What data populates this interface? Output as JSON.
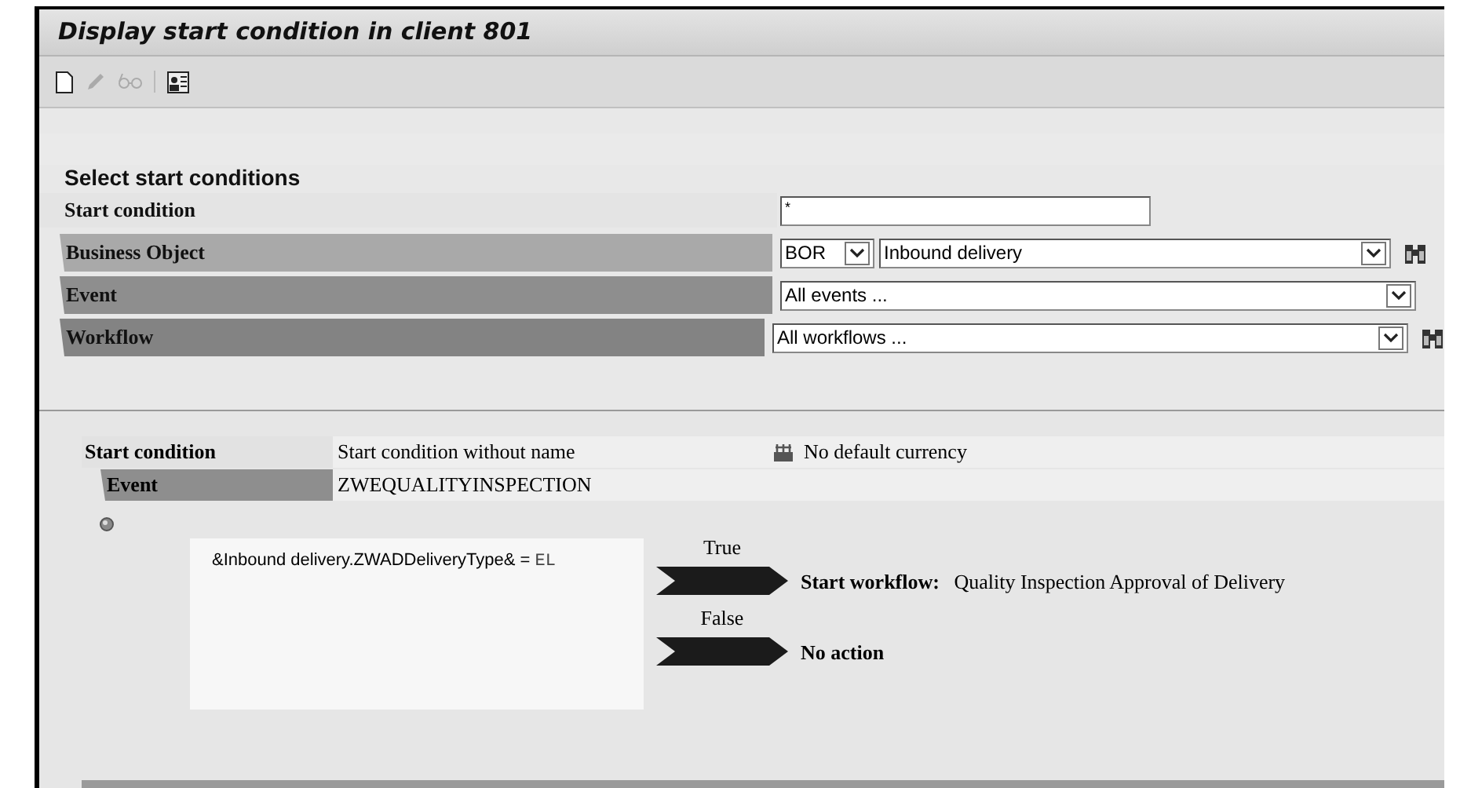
{
  "window": {
    "title": "Display start condition in client 801"
  },
  "toolbar": [
    {
      "kind": "new",
      "disabled": false
    },
    {
      "kind": "edit",
      "disabled": true
    },
    {
      "kind": "glasses",
      "disabled": true
    },
    {
      "kind": "separator"
    },
    {
      "kind": "info",
      "disabled": false
    }
  ],
  "select_section": {
    "title": "Select start conditions",
    "rows": [
      {
        "label": "Start condition",
        "kind": "text",
        "value": "*",
        "search": false
      },
      {
        "label": "Business Object",
        "kind": "object",
        "type_value": "BOR",
        "value": "Inbound delivery",
        "search": true
      },
      {
        "label": "Event",
        "kind": "select",
        "value": "All events ...",
        "search": false
      },
      {
        "label": "Workflow",
        "kind": "select",
        "value": "All workflows ...",
        "search": true
      }
    ]
  },
  "detail": {
    "start_condition_label": "Start condition",
    "start_condition_value": "Start condition without name",
    "currency": "No default currency",
    "event_label": "Event",
    "event_value": "ZWEQUALITYINSPECTION",
    "condition": {
      "expression": "&Inbound delivery.ZWADDeliveryType& = ",
      "operand": "EL"
    },
    "branches": [
      {
        "label": "True",
        "action": "Start workflow:",
        "target": "Quality Inspection Approval of Delivery"
      },
      {
        "label": "False",
        "action": "No action"
      }
    ]
  }
}
